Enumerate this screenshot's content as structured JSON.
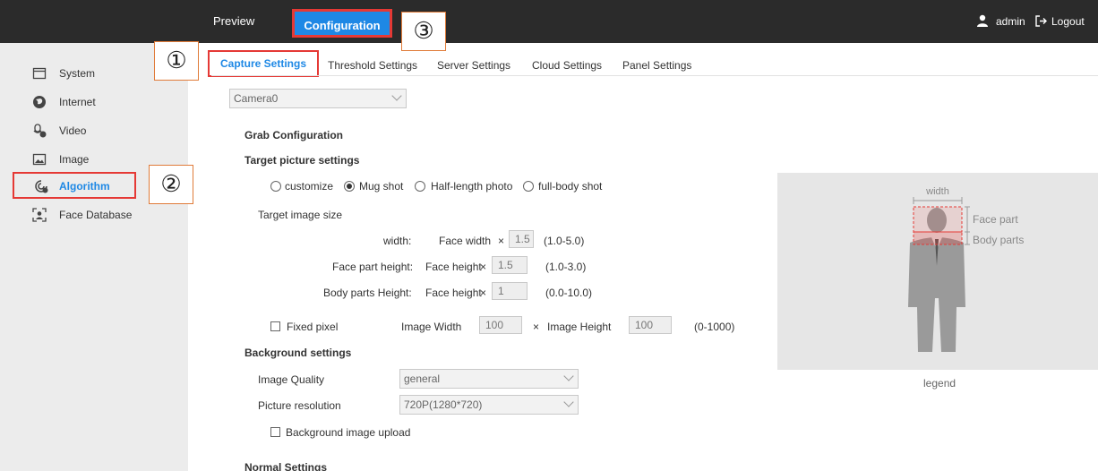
{
  "topbar": {
    "preview": "Preview",
    "configuration": "Configuration",
    "user": "admin",
    "logout": "Logout"
  },
  "sidebar": {
    "items": [
      {
        "label": "System",
        "icon": "monitor-icon"
      },
      {
        "label": "Internet",
        "icon": "globe-icon"
      },
      {
        "label": "Video",
        "icon": "video-icon"
      },
      {
        "label": "Image",
        "icon": "image-icon"
      },
      {
        "label": "Algorithm",
        "icon": "algorithm-icon",
        "active": true
      },
      {
        "label": "Face Database",
        "icon": "face-database-icon"
      }
    ]
  },
  "callouts": [
    "①",
    "②",
    "③"
  ],
  "tabs": [
    "Capture Settings",
    "Threshold Settings",
    "Server Settings",
    "Cloud Settings",
    "Panel Settings"
  ],
  "camera_select": "Camera0",
  "grab": {
    "title": "Grab Configuration",
    "target_title": "Target picture settings",
    "radios": [
      {
        "label": "customize",
        "checked": false
      },
      {
        "label": "Mug shot",
        "checked": true
      },
      {
        "label": "Half-length photo",
        "checked": false
      },
      {
        "label": "full-body shot",
        "checked": false
      }
    ],
    "target_size_label": "Target image size",
    "rows": [
      {
        "label": "width:",
        "ref": "Face width",
        "times": "×",
        "value": "1.5",
        "range": "(1.0-5.0)"
      },
      {
        "label": "Face part height:",
        "ref": "Face height",
        "times": "×",
        "value": "1.5",
        "range": "(1.0-3.0)"
      },
      {
        "label": "Body parts Height:",
        "ref": "Face height",
        "times": "×",
        "value": "1",
        "range": "(0.0-10.0)"
      }
    ],
    "fixed_pixel": "Fixed pixel",
    "image_width_label": "Image Width",
    "image_width": "100",
    "times": "×",
    "image_height_label": "Image Height",
    "image_height": "100",
    "pixel_range": "(0-1000)"
  },
  "background": {
    "title": "Background settings",
    "quality_label": "Image Quality",
    "quality": "general",
    "resolution_label": "Picture resolution",
    "resolution": "720P(1280*720)",
    "upload": "Background image upload"
  },
  "normal": {
    "title": "Normal Settings"
  },
  "legend": {
    "width": "width",
    "face_part": "Face part",
    "body_parts": "Body parts",
    "caption": "legend"
  },
  "colors": {
    "accent": "#1e88e5",
    "highlight": "#e53935",
    "topbar": "#2b2b2b",
    "sidebar": "#ececec"
  }
}
